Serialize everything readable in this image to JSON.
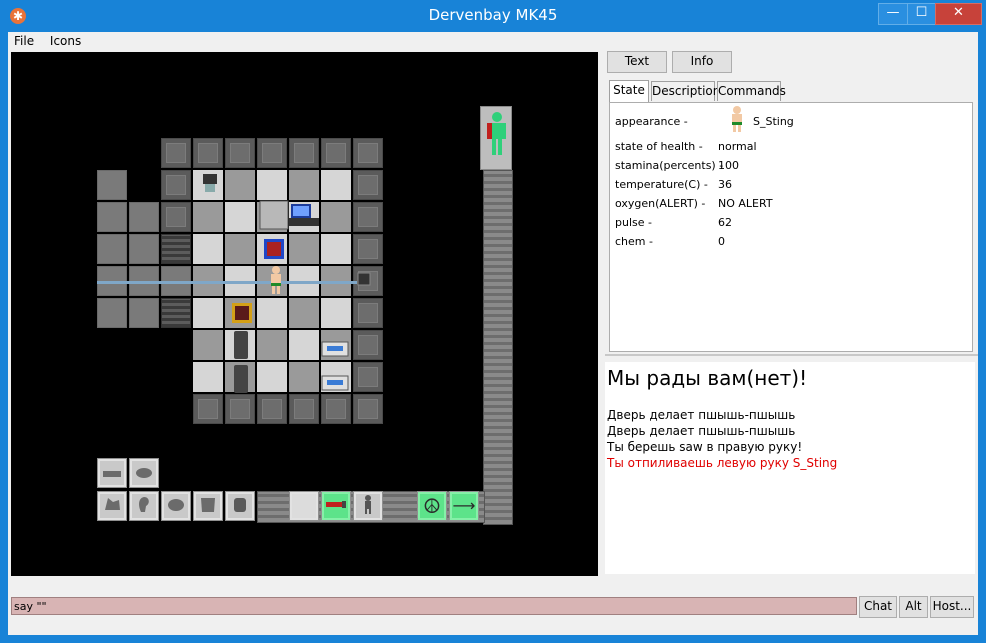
{
  "window": {
    "title": "Dervenbay MK45"
  },
  "menu": {
    "file": "File",
    "icons": "Icons"
  },
  "right_tabs": {
    "text": "Text",
    "info": "Info"
  },
  "sub_tabs": {
    "state": "State",
    "description": "Description",
    "commands": "Commands"
  },
  "state": {
    "appearance_label": "appearance -",
    "appearance_value": "S_Sting",
    "health_label": "state of health -",
    "health_value": "normal",
    "stamina_label": "stamina(percents) -",
    "stamina_value": "100",
    "temperature_label": "temperature(C) -",
    "temperature_value": "36",
    "oxygen_label": "oxygen(ALERT) -",
    "oxygen_value": "NO ALERT",
    "pulse_label": "pulse -",
    "pulse_value": "62",
    "chem_label": "chem -",
    "chem_value": "0"
  },
  "chat": {
    "headline": "Мы рады вам(нет)!",
    "lines": [
      "Дверь делает пшышь-пшышь",
      "Дверь делает пшышь-пшышь",
      "Ты берешь saw в правую руку!",
      "Ты отпиливаешь левую руку S_Sting"
    ],
    "red_color": "#e00000"
  },
  "input": {
    "value": "say \"\""
  },
  "bottom_buttons": {
    "chat": "Chat",
    "alt": "Alt",
    "host": "Host..."
  },
  "hud": {
    "peace_symbol": "☮",
    "arrow": "⟶",
    "slot_icons": [
      "hand-icon",
      "ear-icon",
      "mask-icon",
      "armor-icon",
      "backpack-icon",
      "belt-icon",
      "empty-slot",
      "saw-icon",
      "doll-icon",
      "intent-icon",
      "move-arrow-icon"
    ]
  },
  "colors": {
    "accent": "#1883d7",
    "hud_green": "#5de38a",
    "health_doll": "#2fd07a"
  }
}
